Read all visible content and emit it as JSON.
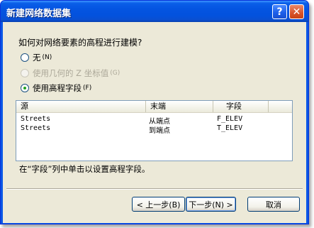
{
  "window": {
    "title": "新建网络数据集"
  },
  "titlebar": {
    "help_label": "?",
    "close_label": "✕"
  },
  "prompt": "如何对网络要素的高程进行建模?",
  "options": [
    {
      "label": "无",
      "shortcut": "(N)",
      "checked": false,
      "enabled": true
    },
    {
      "label": "使用几何的 Z 坐标值",
      "shortcut": "(G)",
      "checked": false,
      "enabled": false
    },
    {
      "label": "使用高程字段",
      "shortcut": "(F)",
      "checked": true,
      "enabled": true
    }
  ],
  "table": {
    "columns": [
      "源",
      "末端",
      "字段"
    ],
    "rows": [
      [
        "Streets",
        "从端点",
        "F_ELEV"
      ],
      [
        "Streets",
        "到端点",
        "T_ELEV"
      ]
    ]
  },
  "note": "在“字段”列中单击以设置高程字段。",
  "buttons": {
    "back": "< 上一步(B)",
    "next": "下一步(N) >",
    "cancel": "取消"
  }
}
